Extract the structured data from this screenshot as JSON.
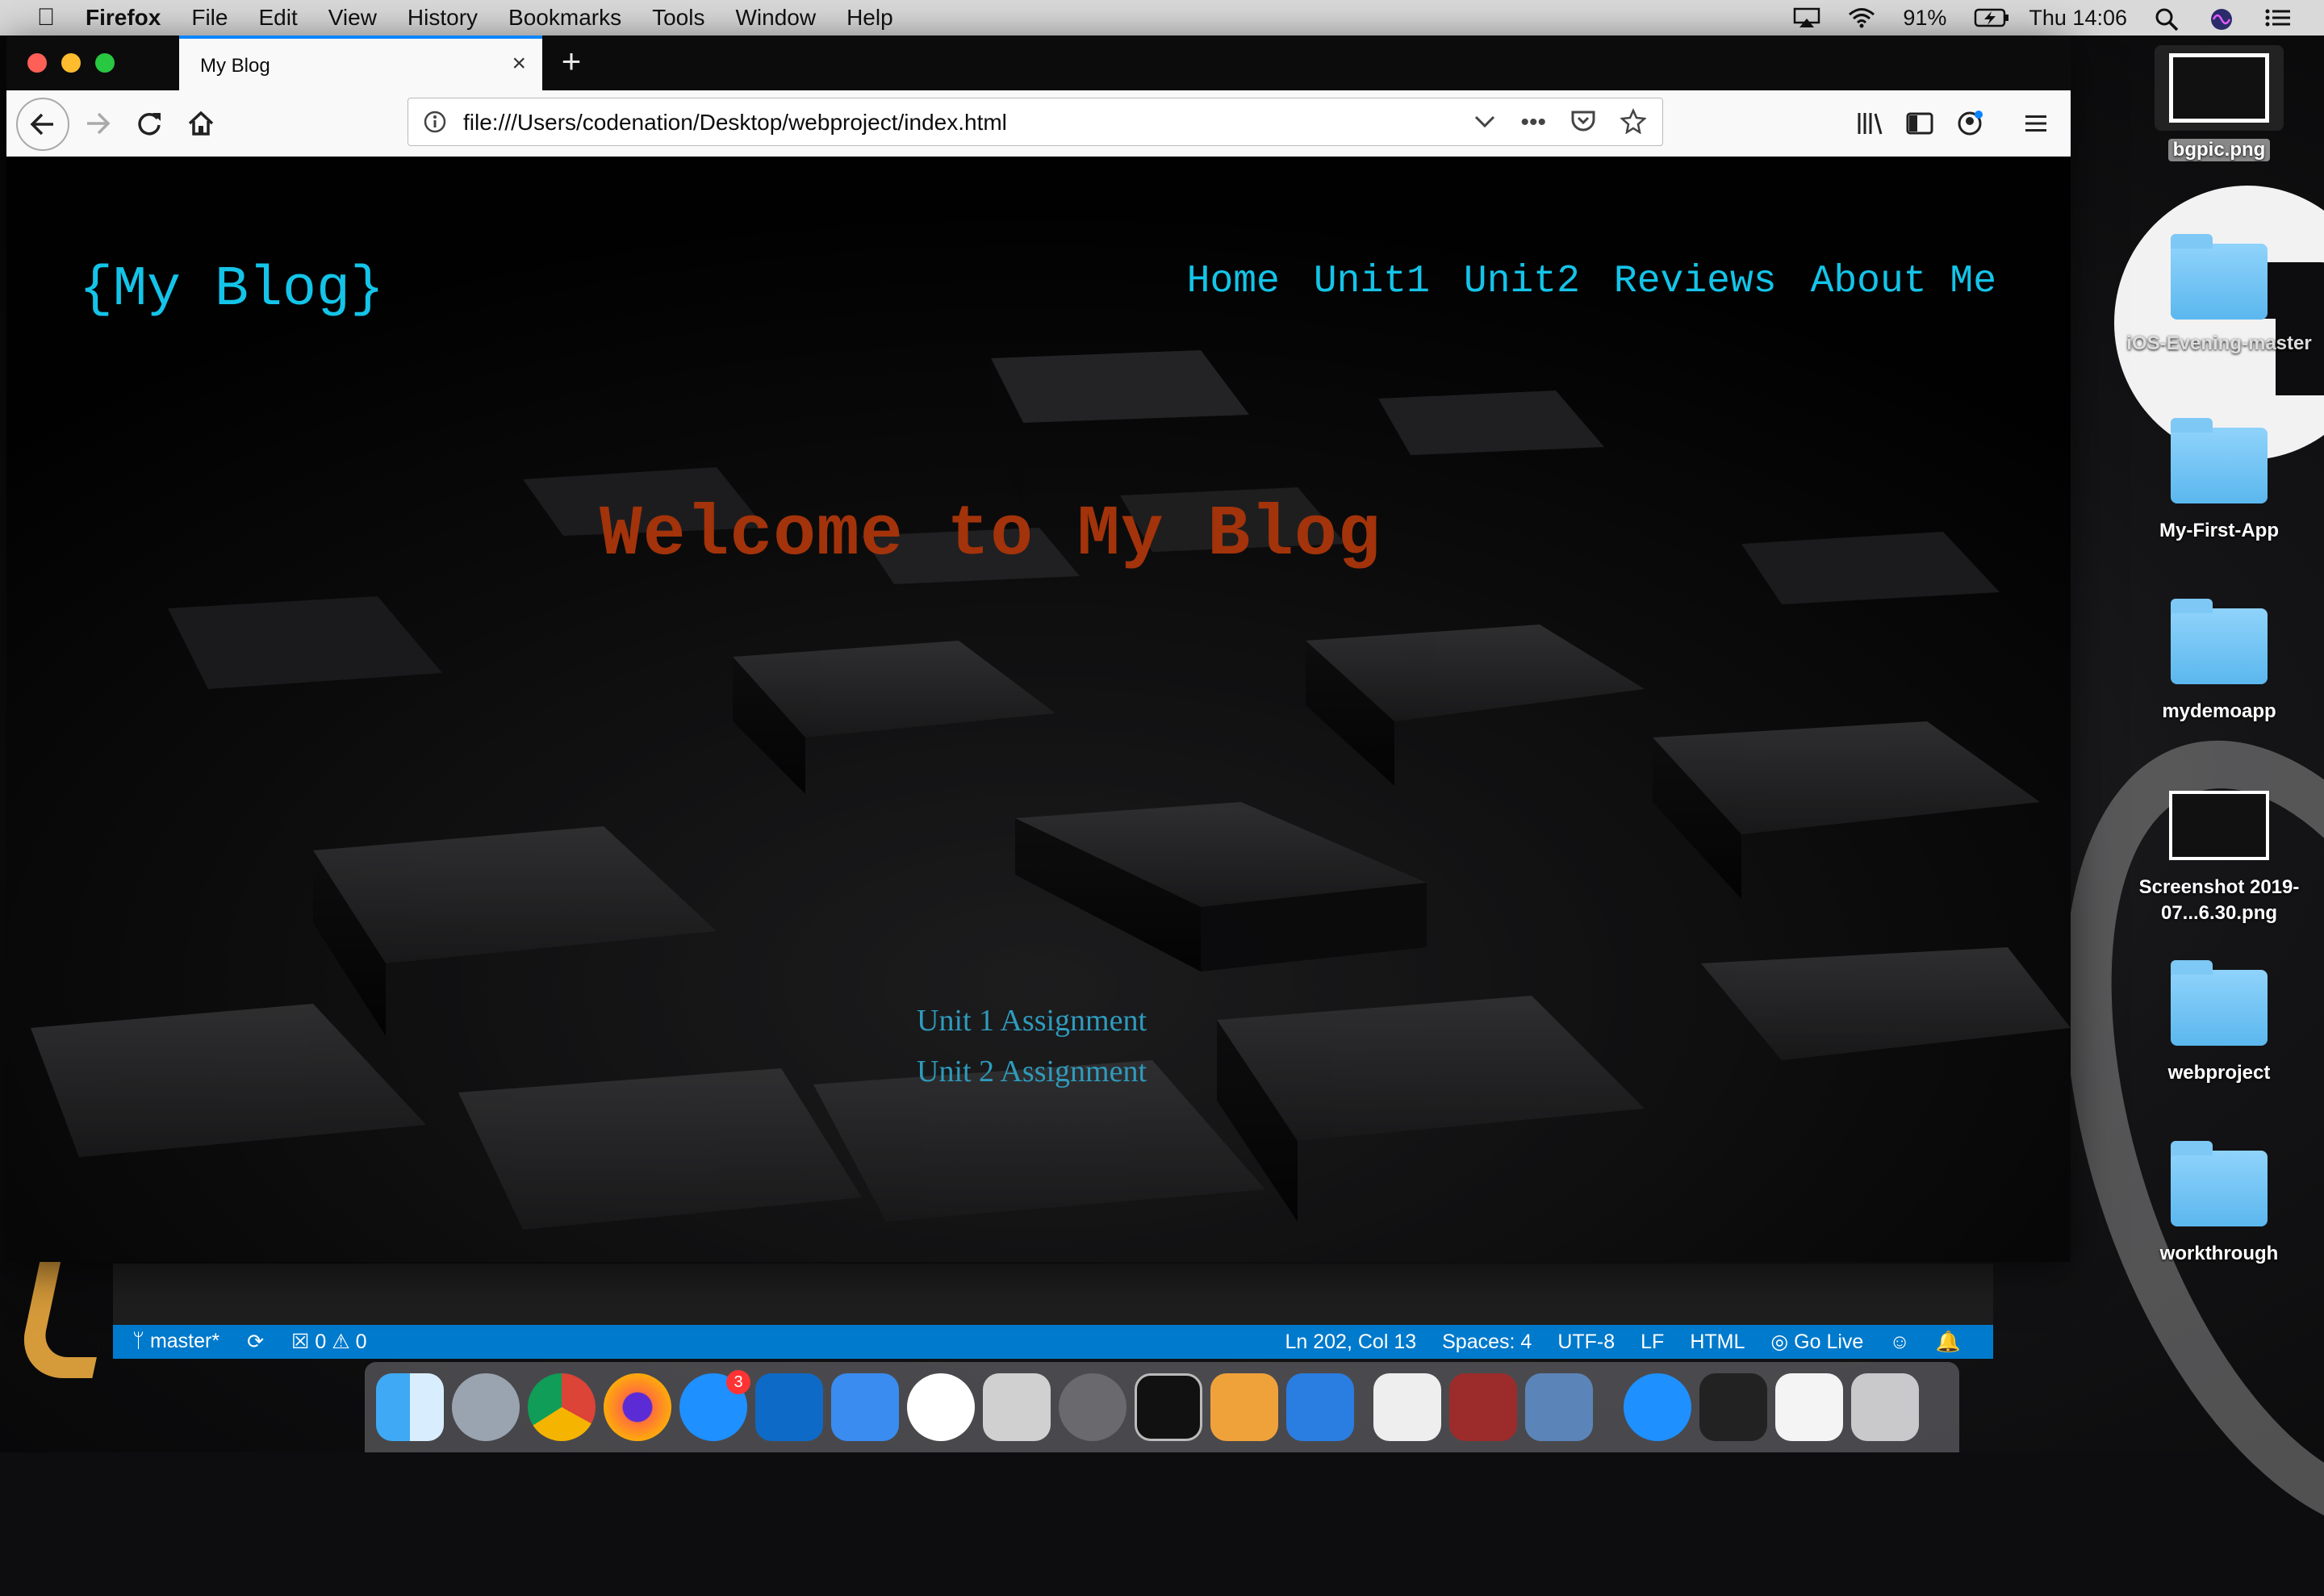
{
  "menubar": {
    "app_name": "Firefox",
    "items": [
      "File",
      "Edit",
      "View",
      "History",
      "Bookmarks",
      "Tools",
      "Window",
      "Help"
    ],
    "battery": "91%",
    "clock": "Thu 14:06"
  },
  "browser": {
    "tab_title": "My Blog",
    "url": "file:///Users/codenation/Desktop/webproject/index.html"
  },
  "page": {
    "logo": "{My Blog}",
    "nav": [
      "Home",
      "Unit1",
      "Unit2",
      "Reviews",
      "About Me"
    ],
    "headline": "Welcome to My Blog",
    "links": [
      "Unit 1 Assignment",
      "Unit 2 Assignment"
    ],
    "colors": {
      "accent": "#14c4e8",
      "headline": "#a3330a",
      "link": "#2f9bbd"
    }
  },
  "editor_status": {
    "branch": "master*",
    "errors": "0",
    "warnings": "0",
    "position": "Ln 202, Col 13",
    "spaces": "Spaces: 4",
    "encoding": "UTF-8",
    "eol": "LF",
    "language": "HTML",
    "golive": "Go Live"
  },
  "desktop": {
    "icons": [
      {
        "label": "bgpic.png",
        "kind": "image"
      },
      {
        "label": "iOS-Evening-master",
        "kind": "folder"
      },
      {
        "label": "My-First-App",
        "kind": "folder"
      },
      {
        "label": "mydemoapp",
        "kind": "folder"
      },
      {
        "label": "Screenshot 2019-07...6.30.png",
        "kind": "image"
      },
      {
        "label": "webproject",
        "kind": "folder"
      },
      {
        "label": "workthrough",
        "kind": "folder"
      }
    ]
  },
  "dock": {
    "apps": [
      "finder-icon",
      "launchpad-icon",
      "chrome-icon",
      "firefox-icon",
      "app-store-icon",
      "vscode-icon",
      "xcode-icon",
      "slack-icon",
      "screenshot-icon",
      "system-preferences-icon",
      "terminal-icon",
      "pages-icon",
      "keynote-icon",
      "textedit-icon",
      "dictionary-icon",
      "preview-icon",
      "app-store-folder-icon",
      "downloads-icon",
      "documents-icon",
      "trash-icon"
    ],
    "app_store_badge": "3"
  }
}
